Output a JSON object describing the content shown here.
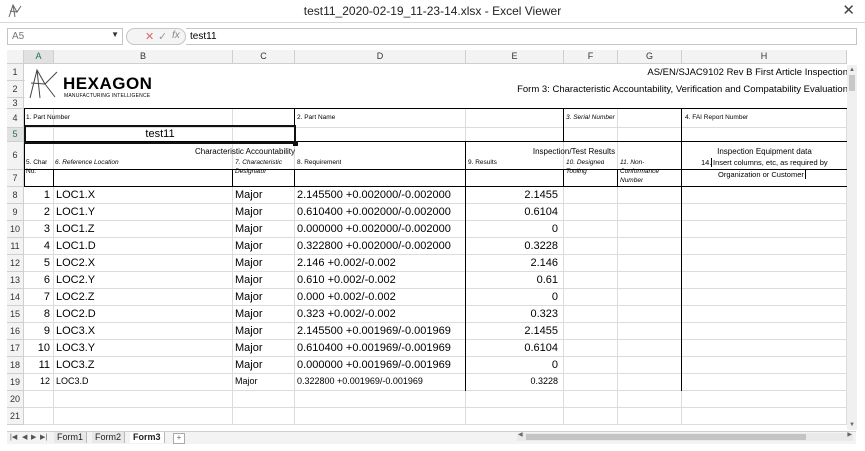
{
  "window": {
    "title": "test11_2020-02-19_11-23-14.xlsx - Excel Viewer",
    "close_glyph": "✕"
  },
  "formula_bar": {
    "name_box": "A5",
    "dropdown_glyph": "▼",
    "buttons": [
      "✕",
      "✓",
      "fx"
    ],
    "value": "test11"
  },
  "columns": [
    "A",
    "B",
    "C",
    "D",
    "E",
    "F",
    "G",
    "H"
  ],
  "selected_column": "A",
  "rows": [
    "1",
    "2",
    "3",
    "4",
    "5",
    "6",
    "7",
    "8",
    "9",
    "10",
    "11",
    "12",
    "13",
    "14",
    "15",
    "16",
    "17",
    "18",
    "19",
    "20",
    "21"
  ],
  "selected_row": "5",
  "logo": {
    "word": "HEXAGON",
    "tagline": "MANUFACTURING INTELLIGENCE"
  },
  "header": {
    "standard": "AS/EN/SJAC9102 Rev B First Article Inspection",
    "form_title": "Form 3: Characteristic Accountability, Verification and Compatability Evaluation"
  },
  "fields": {
    "part_number_label": "1. Part Number",
    "part_number_value": "test11",
    "part_name_label": "2. Part Name",
    "serial_number_label": "3. Serial Number",
    "fai_report_label": "4. FAI Report Number"
  },
  "sections": {
    "characteristic": "Characteristic Accountability",
    "inspection": "Inspection/Test Results",
    "equipment": "Inspection Equipment data"
  },
  "col_headers": {
    "char_no_1": "5. Char",
    "char_no_2": "No.",
    "ref_location": "6. Reference Location",
    "designator_1": "7. Characteristic",
    "designator_2": "Designator",
    "requirement": "8. Requirement",
    "results": "9. Results",
    "tooling_1": "10. Designed",
    "tooling_2": "Tooling",
    "nonconf_1": "11. Non-",
    "nonconf_2": "Conformance",
    "nonconf_3": "Number",
    "equipment_note_num": "14.",
    "equipment_note_1": "Insert columns, etc, as required by",
    "equipment_note_2": "Organization or Customer"
  },
  "data_rows": [
    {
      "no": "1",
      "loc": "LOC1.X",
      "des": "Major",
      "req": "2.145500  +0.002000/-0.002000",
      "res": "2.1455"
    },
    {
      "no": "2",
      "loc": "LOC1.Y",
      "des": "Major",
      "req": "0.610400  +0.002000/-0.002000",
      "res": "0.6104"
    },
    {
      "no": "3",
      "loc": "LOC1.Z",
      "des": "Major",
      "req": "0.000000  +0.002000/-0.002000",
      "res": "0"
    },
    {
      "no": "4",
      "loc": "LOC1.D",
      "des": "Major",
      "req": "0.322800  +0.002000/-0.002000",
      "res": "0.3228"
    },
    {
      "no": "5",
      "loc": "LOC2.X",
      "des": "Major",
      "req": "2.146  +0.002/-0.002",
      "res": "2.146"
    },
    {
      "no": "6",
      "loc": "LOC2.Y",
      "des": "Major",
      "req": "0.610  +0.002/-0.002",
      "res": "0.61"
    },
    {
      "no": "7",
      "loc": "LOC2.Z",
      "des": "Major",
      "req": "0.000  +0.002/-0.002",
      "res": "0"
    },
    {
      "no": "8",
      "loc": "LOC2.D",
      "des": "Major",
      "req": "0.323  +0.002/-0.002",
      "res": "0.323"
    },
    {
      "no": "9",
      "loc": "LOC3.X",
      "des": "Major",
      "req": "2.145500  +0.001969/-0.001969",
      "res": "2.1455"
    },
    {
      "no": "10",
      "loc": "LOC3.Y",
      "des": "Major",
      "req": "0.610400  +0.001969/-0.001969",
      "res": "0.6104"
    },
    {
      "no": "11",
      "loc": "LOC3.Z",
      "des": "Major",
      "req": "0.000000  +0.001969/-0.001969",
      "res": "0"
    },
    {
      "no": "12",
      "loc": "LOC3.D",
      "des": "Major",
      "req": "0.322800  +0.001969/-0.001969",
      "res": "0.3228"
    }
  ],
  "tabs": [
    {
      "label": "Form1"
    },
    {
      "label": "Form2"
    },
    {
      "label": "Form3"
    }
  ],
  "active_tab": "Form3",
  "nav_buttons": [
    "|◀",
    "◀",
    "▶",
    "▶|"
  ],
  "tab_add_glyph": "+",
  "colors": {
    "accent_green": "#217346",
    "grid": "#dcdcdc",
    "header_bg": "#f3f3f3"
  }
}
